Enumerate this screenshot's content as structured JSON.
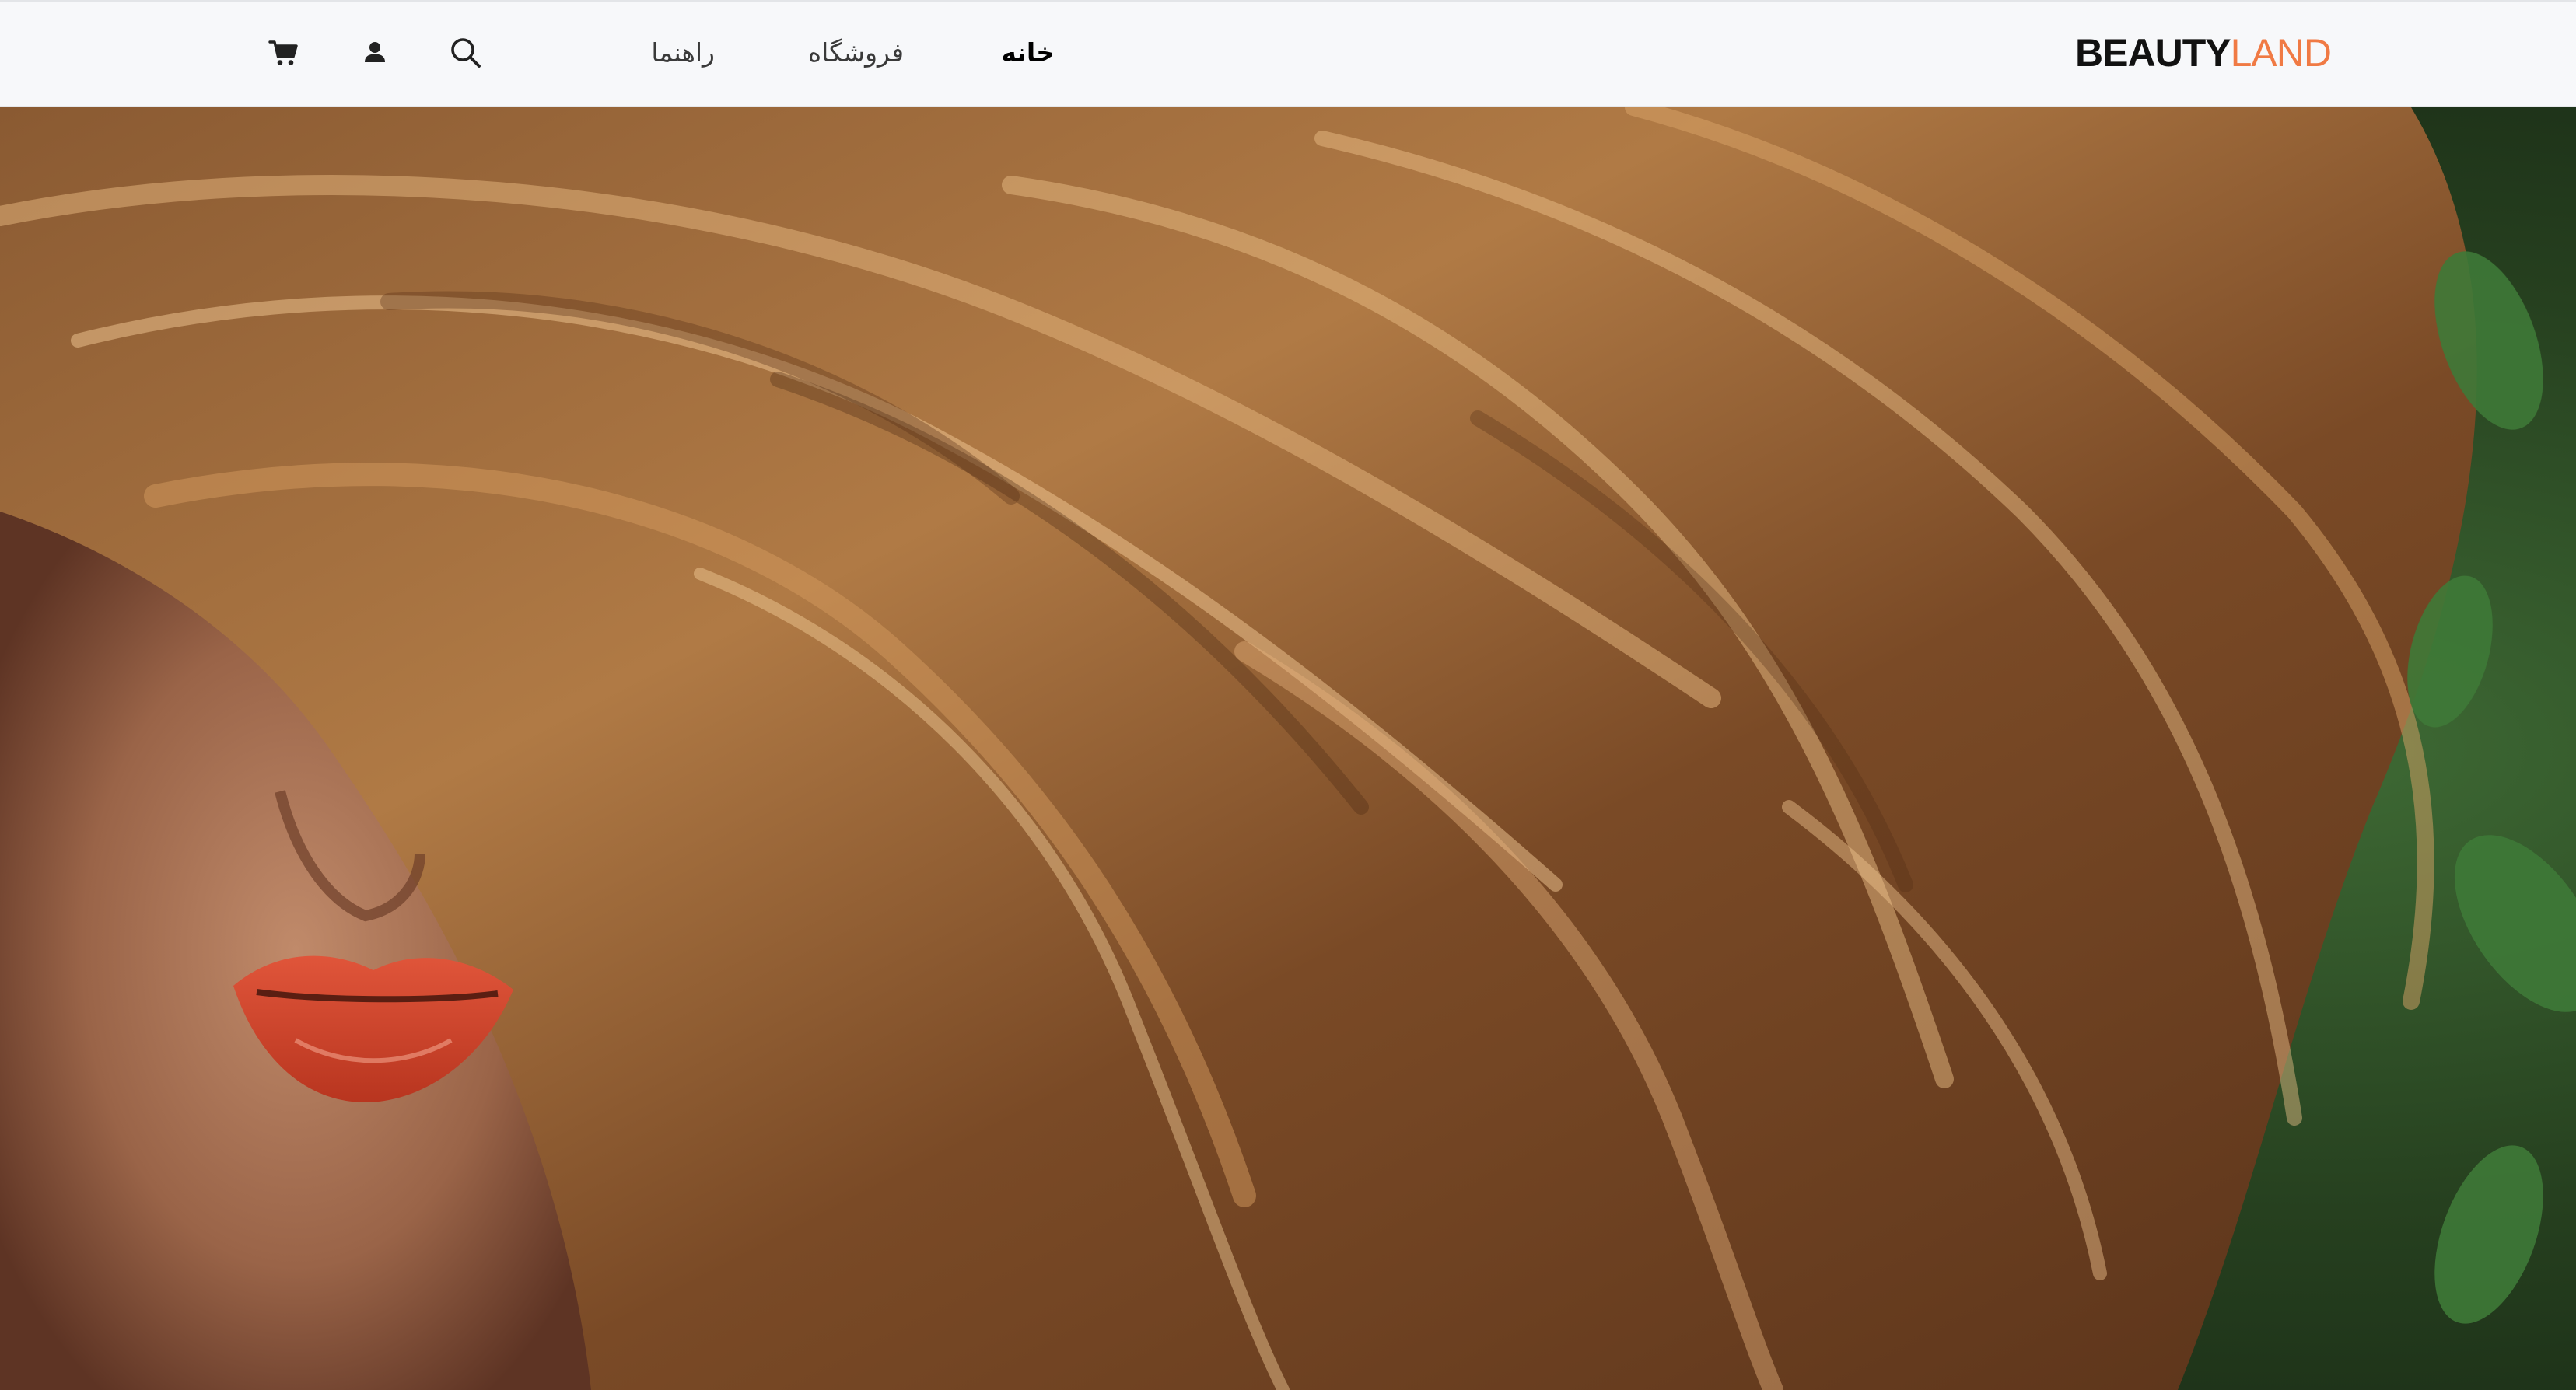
{
  "brand": {
    "part1": "BEAUTY",
    "part2": "LAND"
  },
  "nav": {
    "home": "خانه",
    "shop": "فروشگاه",
    "guide": "راهنما"
  },
  "icons": {
    "search": "search-icon",
    "user": "user-icon",
    "cart": "cart-icon"
  },
  "colors": {
    "navbar_bg": "#f7f8fa",
    "brand_dark": "#111111",
    "brand_accent": "#f07a44"
  }
}
